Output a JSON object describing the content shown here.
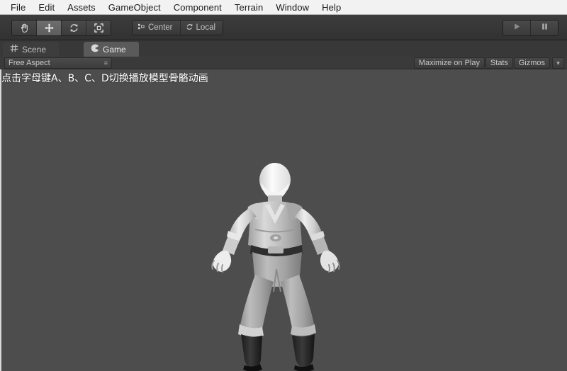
{
  "app": {
    "title": "Unity Editor",
    "background_color": "#4d4d4d",
    "menubar_color": "#f2f2f2",
    "chrome_color": "#3a3a3a"
  },
  "menubar": {
    "items": [
      {
        "label": "File"
      },
      {
        "label": "Edit"
      },
      {
        "label": "Assets"
      },
      {
        "label": "GameObject"
      },
      {
        "label": "Component"
      },
      {
        "label": "Terrain"
      },
      {
        "label": "Window"
      },
      {
        "label": "Help"
      }
    ]
  },
  "toolbar": {
    "transform_tools": [
      {
        "name": "hand-tool",
        "icon": "hand-icon",
        "active": false
      },
      {
        "name": "move-tool",
        "icon": "move-icon",
        "active": true
      },
      {
        "name": "rotate-tool",
        "icon": "rotate-icon",
        "active": false
      },
      {
        "name": "scale-tool",
        "icon": "scale-icon",
        "active": false
      }
    ],
    "pivot_mode_label": "Center",
    "pivot_rotation_label": "Local",
    "play_label": "",
    "pause_label": ""
  },
  "tabs": [
    {
      "label": "Scene",
      "icon": "scene-grid-icon",
      "active": false
    },
    {
      "label": "Game",
      "icon": "game-pacman-icon",
      "active": true
    }
  ],
  "game_toolbar": {
    "aspect_label": "Free Aspect",
    "aspect_arrow": "≡",
    "maximize_label": "Maximize on Play",
    "stats_label": "Stats",
    "gizmos_label": "Gizmos",
    "gizmos_arrow": "▾"
  },
  "viewport": {
    "hint_text": "点击字母键A、B、C、D切换播放模型骨骼动画",
    "hint_color": "#ffffff",
    "character_description": "grayscale humanoid character model in idle stance"
  }
}
